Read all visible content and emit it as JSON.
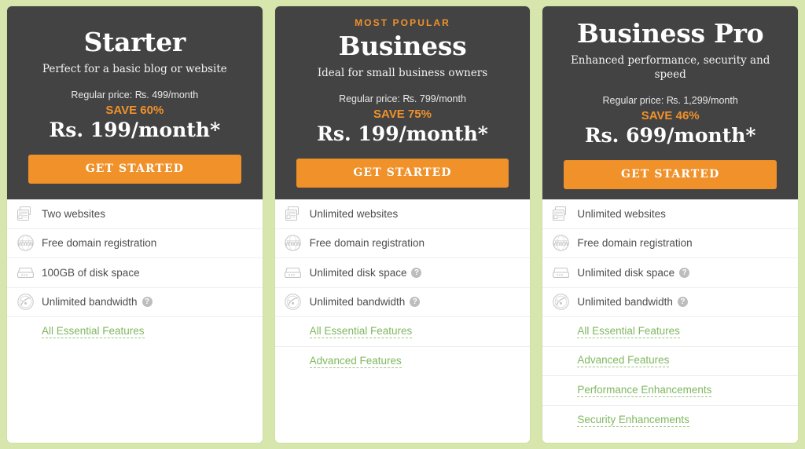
{
  "theme": {
    "page_background": "#d7e6ad",
    "card_header_background": "#434343",
    "accent_orange": "#f0912a",
    "link_green": "#7fb860",
    "card_border": "#cfe0a6"
  },
  "plans": [
    {
      "badge": "",
      "name": "Starter",
      "tagline": "Perfect for a basic blog or website",
      "regular_price": "Regular price: ₨. 499/month",
      "save": "SAVE 60%",
      "price": "Rs. 199/month*",
      "cta": "GET STARTED",
      "features": [
        {
          "icon": "websites-icon",
          "label": "Two websites",
          "help": false
        },
        {
          "icon": "www-globe-icon",
          "label": "Free domain registration",
          "help": false
        },
        {
          "icon": "disk-drive-icon",
          "label": "100GB of disk space",
          "help": false
        },
        {
          "icon": "bandwidth-gauge-icon",
          "label": "Unlimited bandwidth",
          "help": true
        }
      ],
      "links": [
        "All Essential Features"
      ]
    },
    {
      "badge": "MOST POPULAR",
      "name": "Business",
      "tagline": "Ideal for small business owners",
      "regular_price": "Regular price: ₨. 799/month",
      "save": "SAVE 75%",
      "price": "Rs. 199/month*",
      "cta": "GET STARTED",
      "features": [
        {
          "icon": "websites-icon",
          "label": "Unlimited websites",
          "help": false
        },
        {
          "icon": "www-globe-icon",
          "label": "Free domain registration",
          "help": false
        },
        {
          "icon": "disk-drive-icon",
          "label": "Unlimited disk space",
          "help": true
        },
        {
          "icon": "bandwidth-gauge-icon",
          "label": "Unlimited bandwidth",
          "help": true
        }
      ],
      "links": [
        "All Essential Features",
        "Advanced Features"
      ]
    },
    {
      "badge": "",
      "name": "Business Pro",
      "tagline": "Enhanced performance, security and speed",
      "regular_price": "Regular price: ₨. 1,299/month",
      "save": "SAVE 46%",
      "price": "Rs. 699/month*",
      "cta": "GET STARTED",
      "features": [
        {
          "icon": "websites-icon",
          "label": "Unlimited websites",
          "help": false
        },
        {
          "icon": "www-globe-icon",
          "label": "Free domain registration",
          "help": false
        },
        {
          "icon": "disk-drive-icon",
          "label": "Unlimited disk space",
          "help": true
        },
        {
          "icon": "bandwidth-gauge-icon",
          "label": "Unlimited bandwidth",
          "help": true
        }
      ],
      "links": [
        "All Essential Features",
        "Advanced Features",
        "Performance Enhancements",
        "Security Enhancements"
      ]
    }
  ],
  "help_glyph": "?"
}
